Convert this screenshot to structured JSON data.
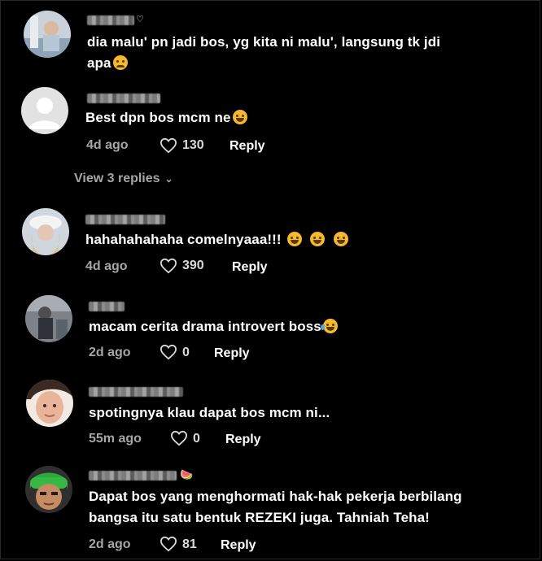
{
  "colors": {
    "background": "#000000",
    "text": "#ffffff",
    "meta": "#a6a6a6",
    "emoji": "#f5b82e"
  },
  "comments": [
    {
      "text_lines": [
        "dia malu' pn jadi bos, yg kita ni malu', langsung tk jdi",
        "apa"
      ],
      "emoji_icons": [
        "weary-face-emoji-icon"
      ],
      "username_suffix": "♡"
    },
    {
      "text": "Best dpn bos mcm ne",
      "emoji_icons": [
        "rolling-laughing-emoji-icon"
      ],
      "time": "4d ago",
      "likes": "130",
      "reply": "Reply"
    },
    {
      "text": "hahahahahaha comelnyaaa!!! ",
      "emoji_icons": [
        "rolling-laughing-emoji-icon",
        "rolling-laughing-emoji-icon",
        "rolling-laughing-emoji-icon"
      ],
      "time": "4d ago",
      "likes": "390",
      "reply": "Reply"
    },
    {
      "text": "macam cerita drama introvert boss",
      "emoji_icons": [
        "tears-of-joy-emoji-icon"
      ],
      "time": "2d ago",
      "likes": "0",
      "reply": "Reply"
    },
    {
      "text": "spotingnya klau dapat bos mcm ni...",
      "time": "55m ago",
      "likes": "0",
      "reply": "Reply"
    },
    {
      "text_lines": [
        "Dapat bos yang menghormati hak-hak pekerja berbilang",
        "bangsa itu satu bentuk REZEKI juga. Tahniah Teha!"
      ],
      "username_suffix": "🍉",
      "time": "2d ago",
      "likes": "81",
      "reply": "Reply"
    }
  ],
  "view_replies": "View 3 replies",
  "icons": {
    "heart": "heart-outline-icon",
    "chevron": "chevron-down-icon",
    "default_avatar": "default-avatar-icon"
  }
}
